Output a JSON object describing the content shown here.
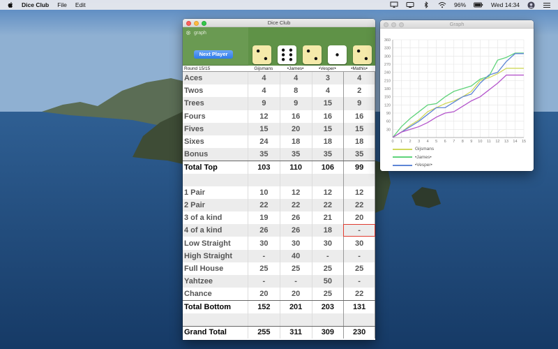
{
  "menubar": {
    "app_name": "Dice Club",
    "items": [
      "File",
      "Edit"
    ],
    "battery": "96%",
    "clock": "Wed 14:34"
  },
  "dice_window": {
    "title": "Dice Club",
    "graph_label": "graph",
    "next_player_label": "Next Player",
    "dice": [
      {
        "value": 2,
        "color": "#f5eaaa"
      },
      {
        "value": 6,
        "color": "#ffffff"
      },
      {
        "value": 2,
        "color": "#f5eaaa"
      },
      {
        "value": 1,
        "color": "#ffffff"
      },
      {
        "value": 2,
        "color": "#f5eaaa"
      }
    ],
    "round_label": "Round 15/15",
    "players": [
      "Gijsmans",
      "•James•",
      "•Vesper•",
      "•Mathis•"
    ],
    "rows": [
      {
        "label": "Aces",
        "values": [
          "4",
          "4",
          "3",
          "4"
        ]
      },
      {
        "label": "Twos",
        "values": [
          "4",
          "8",
          "4",
          "2"
        ]
      },
      {
        "label": "Trees",
        "values": [
          "9",
          "9",
          "15",
          "9"
        ]
      },
      {
        "label": "Fours",
        "values": [
          "12",
          "16",
          "16",
          "16"
        ]
      },
      {
        "label": "Fives",
        "values": [
          "15",
          "20",
          "15",
          "15"
        ]
      },
      {
        "label": "Sixes",
        "values": [
          "24",
          "18",
          "18",
          "18"
        ]
      },
      {
        "label": "Bonus",
        "values": [
          "35",
          "35",
          "35",
          "35"
        ]
      },
      {
        "label": "Total Top",
        "values": [
          "103",
          "110",
          "106",
          "99"
        ],
        "total": true
      },
      {
        "label": "",
        "values": [
          "",
          "",
          "",
          ""
        ],
        "blank": true
      },
      {
        "label": "1 Pair",
        "values": [
          "10",
          "12",
          "12",
          "12"
        ]
      },
      {
        "label": "2 Pair",
        "values": [
          "22",
          "22",
          "22",
          "22"
        ]
      },
      {
        "label": "3 of a kind",
        "values": [
          "19",
          "26",
          "21",
          "20"
        ]
      },
      {
        "label": "4 of a kind",
        "values": [
          "26",
          "26",
          "18",
          "-"
        ],
        "selected": 3
      },
      {
        "label": "Low Straight",
        "values": [
          "30",
          "30",
          "30",
          "30"
        ]
      },
      {
        "label": "High Straight",
        "values": [
          "-",
          "40",
          "-",
          "-"
        ]
      },
      {
        "label": "Full House",
        "values": [
          "25",
          "25",
          "25",
          "25"
        ]
      },
      {
        "label": "Yahtzee",
        "values": [
          "-",
          "-",
          "50",
          "-"
        ]
      },
      {
        "label": "Chance",
        "values": [
          "20",
          "20",
          "25",
          "22"
        ]
      },
      {
        "label": "Total Bottom",
        "values": [
          "152",
          "201",
          "203",
          "131"
        ],
        "total": true
      },
      {
        "label": "",
        "values": [
          "",
          "",
          "",
          ""
        ],
        "blank": true
      },
      {
        "label": "Grand Total",
        "values": [
          "255",
          "311",
          "309",
          "230"
        ],
        "total": true
      }
    ]
  },
  "graph_window": {
    "title": "Graph"
  },
  "chart_data": {
    "type": "line",
    "x": [
      0,
      1,
      2,
      3,
      4,
      5,
      6,
      7,
      8,
      9,
      10,
      11,
      12,
      13,
      14,
      15
    ],
    "xlim": [
      0,
      15
    ],
    "ylim": [
      0,
      360
    ],
    "y_ticks": [
      30,
      60,
      90,
      120,
      150,
      180,
      210,
      240,
      270,
      300,
      330,
      360
    ],
    "x_ticks": [
      0,
      1,
      2,
      3,
      4,
      5,
      6,
      7,
      8,
      9,
      10,
      11,
      12,
      13,
      14,
      15
    ],
    "grid": true,
    "legend_placement": "bottom-left",
    "series": [
      {
        "name": "Gijsmans",
        "color": "#cfd85a",
        "values": [
          0,
          20,
          45,
          65,
          95,
          110,
          125,
          135,
          150,
          170,
          210,
          220,
          235,
          255,
          255,
          255
        ]
      },
      {
        "name": "•James•",
        "color": "#5fd37a",
        "values": [
          0,
          40,
          70,
          95,
          120,
          125,
          150,
          170,
          180,
          190,
          215,
          225,
          285,
          295,
          311,
          311
        ]
      },
      {
        "name": "•Vesper•",
        "color": "#5e86d6",
        "values": [
          0,
          20,
          40,
          60,
          85,
          110,
          110,
          130,
          150,
          160,
          200,
          230,
          240,
          280,
          309,
          309
        ]
      },
      {
        "name": "•Mathis•",
        "color": "#b455cc",
        "values": [
          0,
          20,
          30,
          40,
          55,
          75,
          90,
          95,
          115,
          135,
          150,
          175,
          200,
          230,
          230,
          230
        ]
      }
    ]
  }
}
